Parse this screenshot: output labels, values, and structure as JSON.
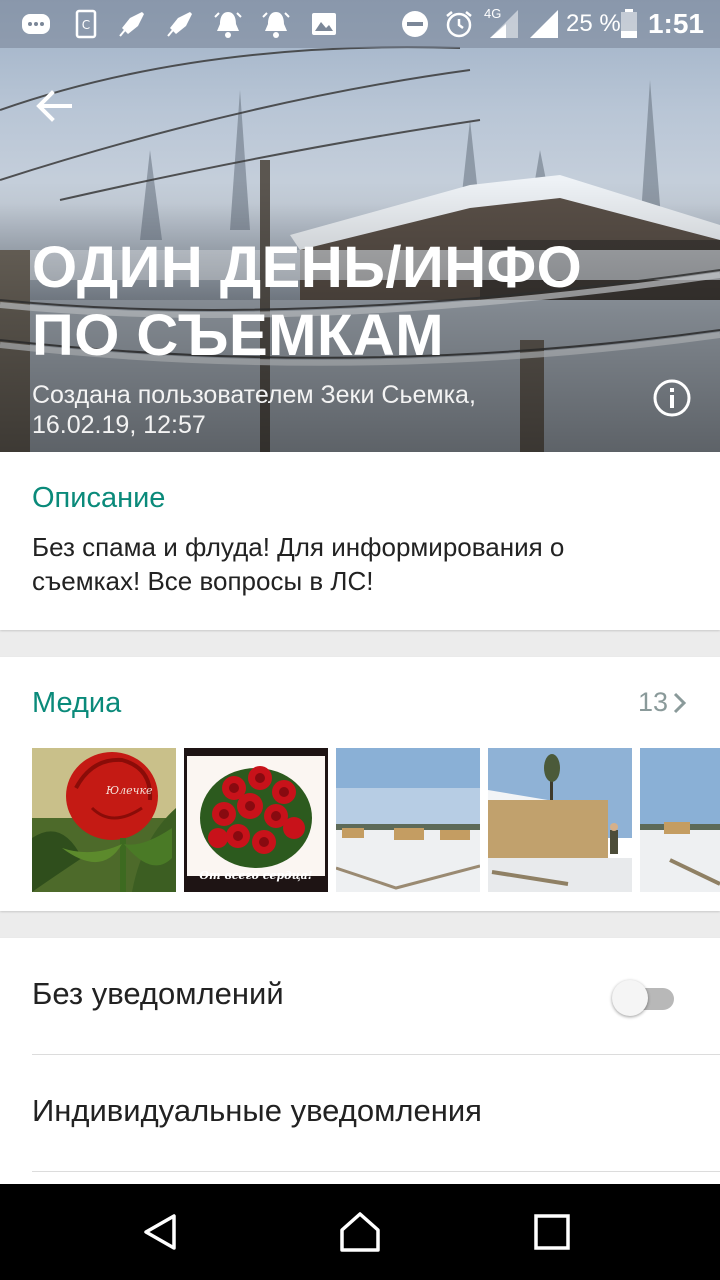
{
  "status_bar": {
    "icons": [
      "messages-icon",
      "android-device-icon",
      "rocket-icon",
      "rocket-icon",
      "alarm-bell-icon",
      "alarm-bell-icon",
      "image-icon",
      "do-not-disturb-icon",
      "alarm-clock-icon",
      "signal-4g-icon",
      "signal-icon",
      "battery-icon"
    ],
    "network": "4G",
    "battery": "25 %",
    "time": "1:51"
  },
  "header": {
    "title_line1": "ОДИН ДЕНЬ/ИНФО",
    "title_line2": "ПО СЪЕМКАМ",
    "subtitle_line1": "Создана пользователем Зеки Сьемка,",
    "subtitle_line2": "16.02.19, 12:57"
  },
  "description": {
    "heading": "Описание",
    "text_line1": "Без спама и флуда!  Для информирования о",
    "text_line2": "съемках!  Все вопросы в ЛС!"
  },
  "media": {
    "heading": "Медиа",
    "count": "13",
    "thumb_rose_caption": "Юлечке",
    "thumb_bouquet_caption": "От всего сердца!"
  },
  "settings": {
    "mute_label": "Без уведомлений",
    "mute_enabled": false,
    "custom_notifications_label": "Индивидуальные уведомления"
  },
  "colors": {
    "accent": "#0a8a7a",
    "navbar": "#000000"
  }
}
